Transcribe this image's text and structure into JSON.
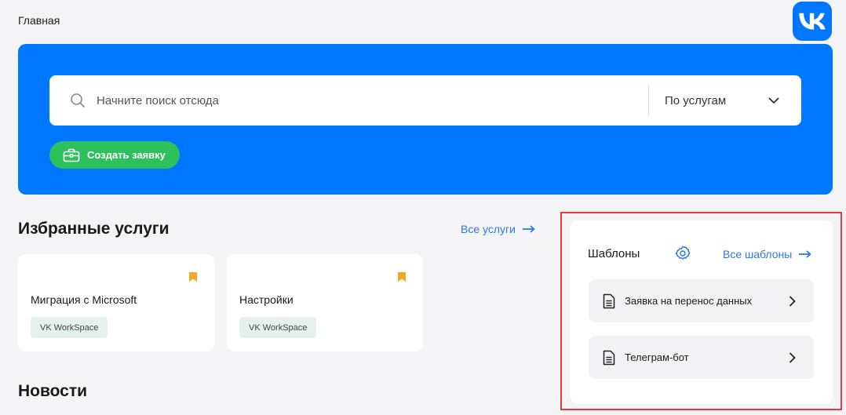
{
  "breadcrumb": {
    "current": "Главная"
  },
  "search": {
    "placeholder": "Начните поиск отсюда",
    "scope": "По услугам"
  },
  "actions": {
    "create_request": "Создать заявку"
  },
  "favorites": {
    "title": "Избранные услуги",
    "all_link": "Все услуги",
    "items": [
      {
        "name": "Миграция с Microsoft",
        "tag": "VK WorkSpace"
      },
      {
        "name": "Настройки",
        "tag": "VK WorkSpace"
      }
    ]
  },
  "news": {
    "title": "Новости"
  },
  "templates": {
    "title": "Шаблоны",
    "all_link": "Все шаблоны",
    "items": [
      {
        "label": "Заявка на перенос данных"
      },
      {
        "label": "Телеграм-бот"
      }
    ]
  },
  "colors": {
    "brand": "#0077ff",
    "action_green": "#2ec05a",
    "link": "#2a7ae2",
    "bookmark": "#f5a623",
    "highlight": "#e8393e"
  },
  "icons": {
    "logo": "vk-logo-icon",
    "search": "search-icon",
    "scope": "chevron-down-icon",
    "create": "briefcase-icon",
    "bookmark": "bookmark-icon",
    "settings": "gear-icon",
    "document": "document-icon",
    "arrow": "arrow-right-icon",
    "chevron": "chevron-right-icon"
  }
}
